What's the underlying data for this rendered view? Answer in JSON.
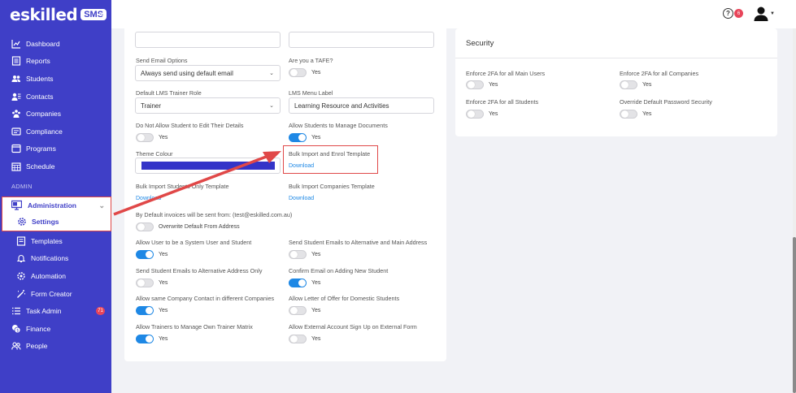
{
  "brand": {
    "logo_text": "eskilled",
    "logo_badge": "SMS",
    "collapse": "«"
  },
  "sidebar": {
    "items": [
      {
        "label": "Dashboard",
        "icon": "chart-line-icon"
      },
      {
        "label": "Reports",
        "icon": "report-icon"
      },
      {
        "label": "Students",
        "icon": "students-icon"
      },
      {
        "label": "Contacts",
        "icon": "contacts-icon"
      },
      {
        "label": "Companies",
        "icon": "companies-icon"
      },
      {
        "label": "Compliance",
        "icon": "compliance-icon"
      },
      {
        "label": "Programs",
        "icon": "programs-icon"
      },
      {
        "label": "Schedule",
        "icon": "schedule-icon"
      }
    ],
    "section_admin": "ADMIN",
    "administration": "Administration",
    "settings": "Settings",
    "sub_items": [
      {
        "label": "Templates",
        "icon": "templates-icon"
      },
      {
        "label": "Notifications",
        "icon": "bell-icon"
      },
      {
        "label": "Automation",
        "icon": "automation-icon"
      },
      {
        "label": "Form Creator",
        "icon": "wand-icon"
      }
    ],
    "task_admin": "Task Admin",
    "task_admin_badge": "71",
    "finance": "Finance",
    "people": "People"
  },
  "topbar": {
    "help": "?",
    "notif_count": "6"
  },
  "form": {
    "send_email_options_label": "Send Email Options",
    "send_email_options_value": "Always send using default email",
    "tafe_label": "Are you a TAFE?",
    "tafe_state": "Yes",
    "trainer_role_label": "Default LMS Trainer Role",
    "trainer_role_value": "Trainer",
    "lms_menu_label": "LMS Menu Label",
    "lms_menu_value": "Learning Resource and Activities",
    "no_edit_label": "Do Not Allow Student to Edit Their Details",
    "no_edit_state": "Yes",
    "manage_docs_label": "Allow Students to Manage Documents",
    "manage_docs_state": "Yes",
    "theme_colour_label": "Theme Colour",
    "theme_colour": "#3434c8",
    "bulk_enrol_label": "Bulk Import and Enrol Template",
    "bulk_enrol_link": "Download",
    "bulk_students_label": "Bulk Import Students Only Template",
    "bulk_students_link": "Download",
    "bulk_companies_label": "Bulk Import Companies Template",
    "bulk_companies_link": "Download",
    "invoices_label": "By Default invoices will be sent from: (test@eskilled.com.au)",
    "override_label": "Overwrite Default From Address",
    "system_user_label": "Allow User to be a System User and Student",
    "system_user_state": "Yes",
    "alt_main_label": "Send Student Emails to Alternative and Main Address",
    "alt_main_state": "Yes",
    "alt_only_label": "Send Student Emails to Alternative Address Only",
    "alt_only_state": "Yes",
    "confirm_email_label": "Confirm Email on Adding New Student",
    "confirm_email_state": "Yes",
    "company_contact_label": "Allow same Company Contact in different Companies",
    "company_contact_state": "Yes",
    "letter_offer_label": "Allow Letter of Offer for Domestic Students",
    "letter_offer_state": "Yes",
    "trainer_matrix_label": "Allow Trainers to Manage Own Trainer Matrix",
    "trainer_matrix_state": "Yes",
    "external_signup_label": "Allow External Account Sign Up on External Form",
    "external_signup_state": "Yes"
  },
  "security": {
    "title": "Security",
    "main_users_label": "Enforce 2FA for all Main Users",
    "main_users_state": "Yes",
    "companies_label": "Enforce 2FA for all Companies",
    "companies_state": "Yes",
    "students_label": "Enforce 2FA for all Students",
    "students_state": "Yes",
    "override_pwd_label": "Override Default Password Security",
    "override_pwd_state": "Yes"
  },
  "colors": {
    "accent": "#3f3fc7",
    "toggle_on": "#1e88e5",
    "highlight": "#e04848"
  }
}
